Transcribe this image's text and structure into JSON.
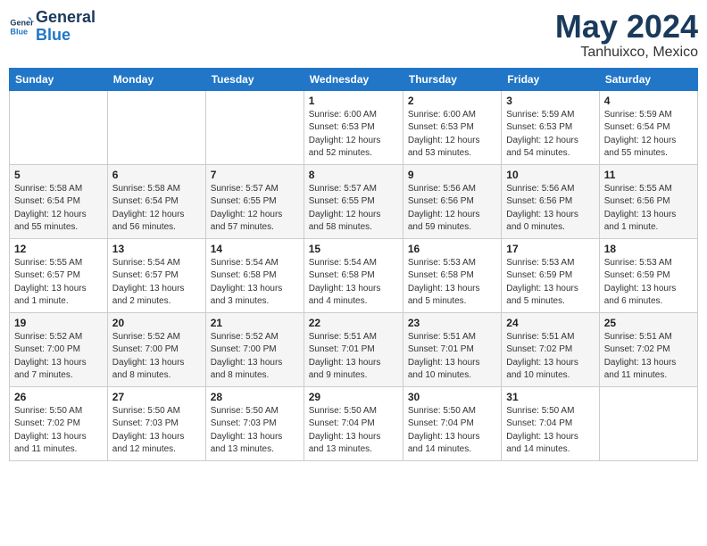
{
  "logo": {
    "line1": "General",
    "line2": "Blue"
  },
  "title": "May 2024",
  "location": "Tanhuixco, Mexico",
  "days_of_week": [
    "Sunday",
    "Monday",
    "Tuesday",
    "Wednesday",
    "Thursday",
    "Friday",
    "Saturday"
  ],
  "weeks": [
    [
      {
        "day": "",
        "info": ""
      },
      {
        "day": "",
        "info": ""
      },
      {
        "day": "",
        "info": ""
      },
      {
        "day": "1",
        "info": "Sunrise: 6:00 AM\nSunset: 6:53 PM\nDaylight: 12 hours\nand 52 minutes."
      },
      {
        "day": "2",
        "info": "Sunrise: 6:00 AM\nSunset: 6:53 PM\nDaylight: 12 hours\nand 53 minutes."
      },
      {
        "day": "3",
        "info": "Sunrise: 5:59 AM\nSunset: 6:53 PM\nDaylight: 12 hours\nand 54 minutes."
      },
      {
        "day": "4",
        "info": "Sunrise: 5:59 AM\nSunset: 6:54 PM\nDaylight: 12 hours\nand 55 minutes."
      }
    ],
    [
      {
        "day": "5",
        "info": "Sunrise: 5:58 AM\nSunset: 6:54 PM\nDaylight: 12 hours\nand 55 minutes."
      },
      {
        "day": "6",
        "info": "Sunrise: 5:58 AM\nSunset: 6:54 PM\nDaylight: 12 hours\nand 56 minutes."
      },
      {
        "day": "7",
        "info": "Sunrise: 5:57 AM\nSunset: 6:55 PM\nDaylight: 12 hours\nand 57 minutes."
      },
      {
        "day": "8",
        "info": "Sunrise: 5:57 AM\nSunset: 6:55 PM\nDaylight: 12 hours\nand 58 minutes."
      },
      {
        "day": "9",
        "info": "Sunrise: 5:56 AM\nSunset: 6:56 PM\nDaylight: 12 hours\nand 59 minutes."
      },
      {
        "day": "10",
        "info": "Sunrise: 5:56 AM\nSunset: 6:56 PM\nDaylight: 13 hours\nand 0 minutes."
      },
      {
        "day": "11",
        "info": "Sunrise: 5:55 AM\nSunset: 6:56 PM\nDaylight: 13 hours\nand 1 minute."
      }
    ],
    [
      {
        "day": "12",
        "info": "Sunrise: 5:55 AM\nSunset: 6:57 PM\nDaylight: 13 hours\nand 1 minute."
      },
      {
        "day": "13",
        "info": "Sunrise: 5:54 AM\nSunset: 6:57 PM\nDaylight: 13 hours\nand 2 minutes."
      },
      {
        "day": "14",
        "info": "Sunrise: 5:54 AM\nSunset: 6:58 PM\nDaylight: 13 hours\nand 3 minutes."
      },
      {
        "day": "15",
        "info": "Sunrise: 5:54 AM\nSunset: 6:58 PM\nDaylight: 13 hours\nand 4 minutes."
      },
      {
        "day": "16",
        "info": "Sunrise: 5:53 AM\nSunset: 6:58 PM\nDaylight: 13 hours\nand 5 minutes."
      },
      {
        "day": "17",
        "info": "Sunrise: 5:53 AM\nSunset: 6:59 PM\nDaylight: 13 hours\nand 5 minutes."
      },
      {
        "day": "18",
        "info": "Sunrise: 5:53 AM\nSunset: 6:59 PM\nDaylight: 13 hours\nand 6 minutes."
      }
    ],
    [
      {
        "day": "19",
        "info": "Sunrise: 5:52 AM\nSunset: 7:00 PM\nDaylight: 13 hours\nand 7 minutes."
      },
      {
        "day": "20",
        "info": "Sunrise: 5:52 AM\nSunset: 7:00 PM\nDaylight: 13 hours\nand 8 minutes."
      },
      {
        "day": "21",
        "info": "Sunrise: 5:52 AM\nSunset: 7:00 PM\nDaylight: 13 hours\nand 8 minutes."
      },
      {
        "day": "22",
        "info": "Sunrise: 5:51 AM\nSunset: 7:01 PM\nDaylight: 13 hours\nand 9 minutes."
      },
      {
        "day": "23",
        "info": "Sunrise: 5:51 AM\nSunset: 7:01 PM\nDaylight: 13 hours\nand 10 minutes."
      },
      {
        "day": "24",
        "info": "Sunrise: 5:51 AM\nSunset: 7:02 PM\nDaylight: 13 hours\nand 10 minutes."
      },
      {
        "day": "25",
        "info": "Sunrise: 5:51 AM\nSunset: 7:02 PM\nDaylight: 13 hours\nand 11 minutes."
      }
    ],
    [
      {
        "day": "26",
        "info": "Sunrise: 5:50 AM\nSunset: 7:02 PM\nDaylight: 13 hours\nand 11 minutes."
      },
      {
        "day": "27",
        "info": "Sunrise: 5:50 AM\nSunset: 7:03 PM\nDaylight: 13 hours\nand 12 minutes."
      },
      {
        "day": "28",
        "info": "Sunrise: 5:50 AM\nSunset: 7:03 PM\nDaylight: 13 hours\nand 13 minutes."
      },
      {
        "day": "29",
        "info": "Sunrise: 5:50 AM\nSunset: 7:04 PM\nDaylight: 13 hours\nand 13 minutes."
      },
      {
        "day": "30",
        "info": "Sunrise: 5:50 AM\nSunset: 7:04 PM\nDaylight: 13 hours\nand 14 minutes."
      },
      {
        "day": "31",
        "info": "Sunrise: 5:50 AM\nSunset: 7:04 PM\nDaylight: 13 hours\nand 14 minutes."
      },
      {
        "day": "",
        "info": ""
      }
    ]
  ]
}
